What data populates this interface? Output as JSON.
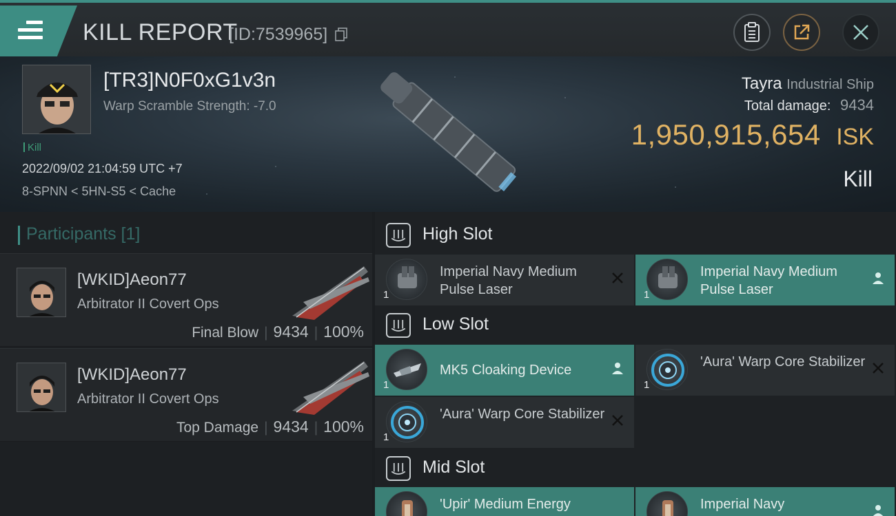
{
  "topbar": {
    "title": "KILL REPORT",
    "report_id": "[ID:7539965]"
  },
  "victim": {
    "name": "[TR3]N0F0xG1v3n",
    "warp_scramble": "Warp Scramble Strength: -7.0",
    "kill_tag": "Kill",
    "date": "2022/09/02 21:04:59 UTC +7",
    "location": "8-SPNN < 5HN-S5 < Cache",
    "ship_name": "Tayra",
    "ship_type": "Industrial Ship",
    "total_damage_label": "Total damage:",
    "total_damage": "9434",
    "isk_value": "1,950,915,654",
    "isk_unit": "ISK",
    "result": "Kill"
  },
  "participants": {
    "title": "Participants [1]",
    "rows": [
      {
        "name": "[WKID]Aeon77",
        "ship": "Arbitrator II Covert Ops",
        "role": "Final Blow",
        "damage": "9434",
        "percent": "100%"
      },
      {
        "name": "[WKID]Aeon77",
        "ship": "Arbitrator II Covert Ops",
        "role": "Top Damage",
        "damage": "9434",
        "percent": "100%"
      }
    ]
  },
  "slots": {
    "high": {
      "title": "High Slot",
      "items": [
        {
          "name": "Imperial Navy Medium Pulse Laser",
          "qty": "1",
          "status": "destroyed"
        },
        {
          "name": "Imperial Navy Medium Pulse Laser",
          "qty": "1",
          "status": "dropped"
        }
      ]
    },
    "low": {
      "title": "Low Slot",
      "items": [
        {
          "name": "MK5 Cloaking Device",
          "qty": "1",
          "status": "dropped"
        },
        {
          "name": "'Aura' Warp Core Stabilizer",
          "qty": "1",
          "status": "destroyed"
        },
        {
          "name": "'Aura' Warp Core Stabilizer",
          "qty": "1",
          "status": "destroyed"
        }
      ]
    },
    "mid": {
      "title": "Mid Slot",
      "items": [
        {
          "name": "'Upir' Medium Energy",
          "qty": "",
          "status": "dropped"
        },
        {
          "name": "Imperial Navy",
          "qty": "",
          "status": "dropped"
        }
      ]
    }
  },
  "colors": {
    "accent": "#3f8f86",
    "isk": "#e0b263",
    "fitted_bg": "#3b8076",
    "item_bg": "#2a2e31"
  }
}
